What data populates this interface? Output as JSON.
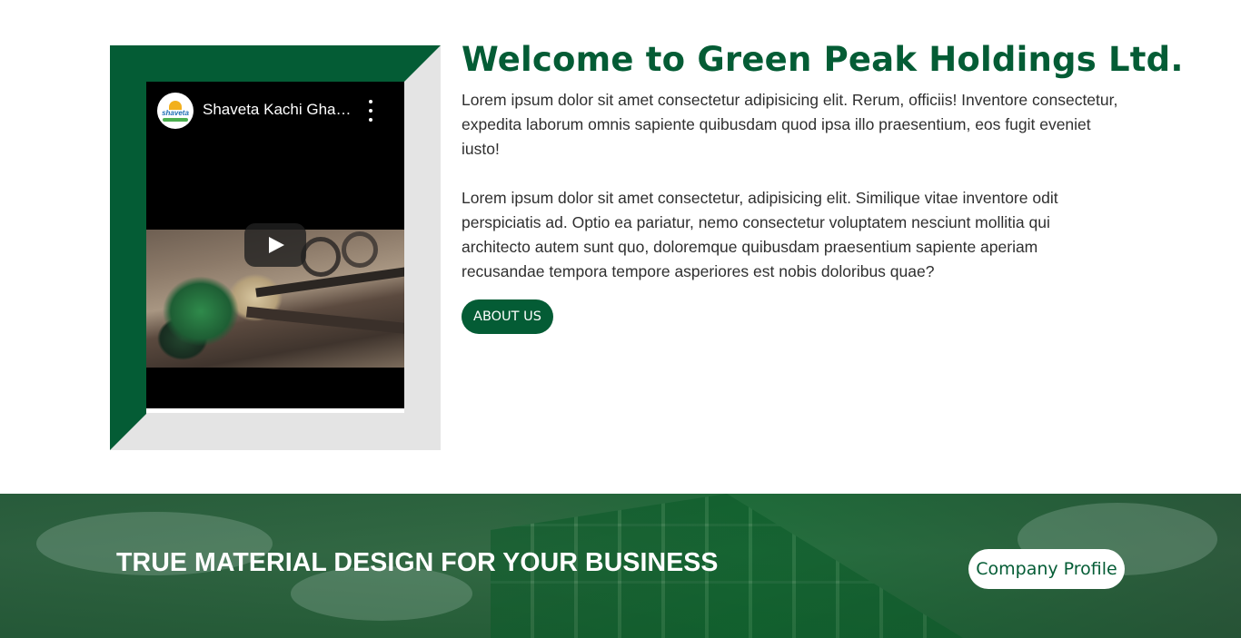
{
  "video": {
    "channel_title": "Shaveta Kachi Gha…",
    "channel_logo_text": "shaveta",
    "play_icon": "play-icon",
    "menu_icon": "more-vert-icon"
  },
  "about": {
    "title": "Welcome to Green Peak Holdings Ltd.",
    "paragraph1": "Lorem ipsum dolor sit amet consectetur adipisicing elit. Rerum, officiis! Inventore consectetur, expedita laborum omnis sapiente quibusdam quod ipsa illo praesentium, eos fugit eveniet iusto!",
    "paragraph2": "Lorem ipsum dolor sit amet consectetur, adipisicing elit. Similique vitae inventore odit perspiciatis ad. Optio ea pariatur, nemo consectetur voluptatem nesciunt mollitia qui architecto autem sunt quo, doloremque quibusdam praesentium sapiente aperiam recusandae tempora tempore asperiores est nobis doloribus quae?",
    "button_label": "ABOUT US"
  },
  "banner": {
    "heading": "TRUE MATERIAL DESIGN FOR YOUR BUSINESS",
    "button_label": "Company Profile"
  },
  "colors": {
    "brand_green": "#045c35",
    "frame_gray": "#e4e4e4",
    "text": "#2f2f2f"
  }
}
